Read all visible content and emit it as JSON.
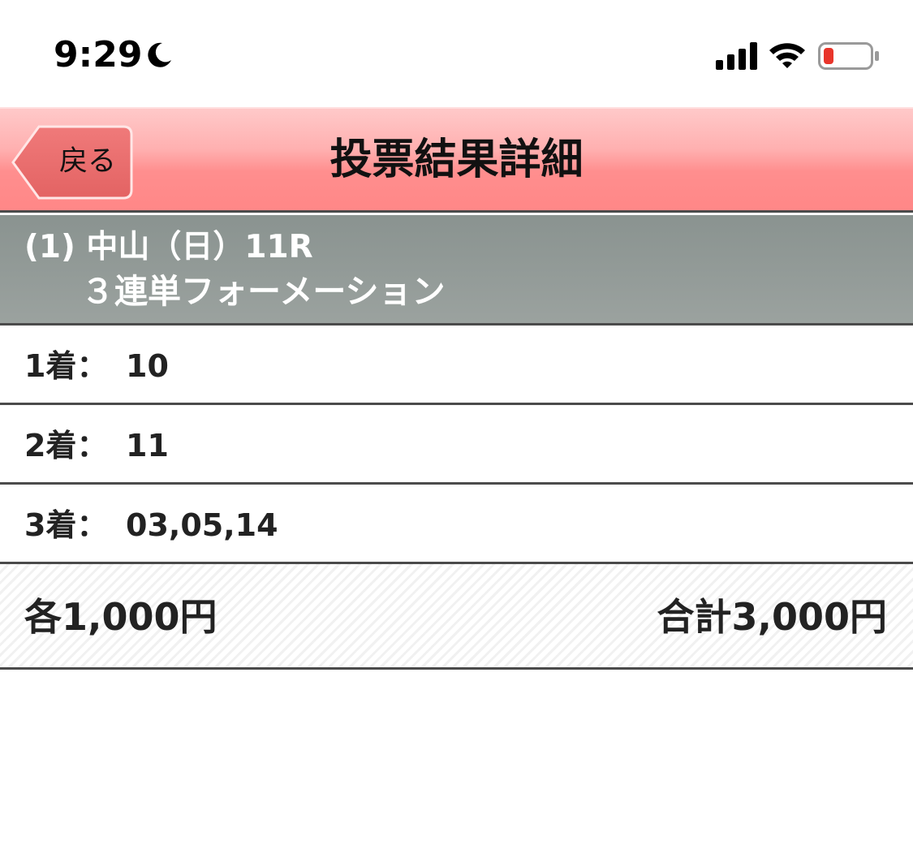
{
  "status_bar": {
    "time": "9:29",
    "battery_color": "#e8352b"
  },
  "header": {
    "back_label": "戻る",
    "title": "投票結果詳細",
    "accent_color": "#ff8e8e"
  },
  "race": {
    "line1": "(1) 中山（日）11R",
    "bet_type": "３連単フォーメーション"
  },
  "selections": [
    {
      "label": "1着：",
      "value": "10"
    },
    {
      "label": "2着：",
      "value": "11"
    },
    {
      "label": "3着：",
      "value": "03,05,14"
    }
  ],
  "summary": {
    "each": "各1,000円",
    "total": "合計3,000円"
  }
}
